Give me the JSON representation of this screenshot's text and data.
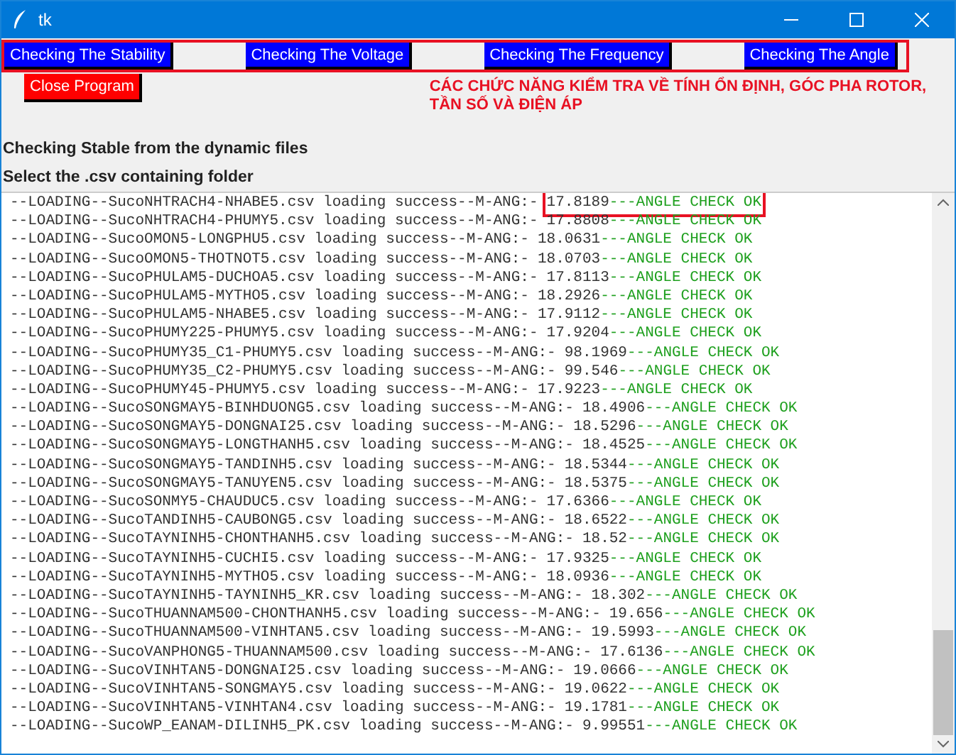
{
  "window": {
    "title": "tk"
  },
  "buttons": [
    {
      "label": "Checking The Stability",
      "kind": "check"
    },
    {
      "label": "Checking The Voltage",
      "kind": "check"
    },
    {
      "label": "Checking The Frequency",
      "kind": "check"
    },
    {
      "label": "Checking The Angle",
      "kind": "check"
    }
  ],
  "close_button": {
    "label": "Close Program"
  },
  "annotation": "CÁC CHỨC NĂNG KIỂM TRA VỀ TÍNH ỔN ĐỊNH, GÓC PHA ROTOR, TẦN SỐ VÀ ĐIỆN ÁP",
  "heading": "Checking Stable from the dynamic files",
  "subheading": "Select the .csv containing folder",
  "log": [
    {
      "prefix": "--LOADING--SucoNHTRACH4-NHABE5.csv loading success--M-ANG:-",
      "value": "17.8189",
      "status": "---ANGLE CHECK OK",
      "highlighted": true
    },
    {
      "prefix": "--LOADING--SucoNHTRACH4-PHUMY5.csv loading success--M-ANG:-",
      "value": "17.8808",
      "status": "---ANGLE CHECK OK",
      "highlighted": false
    },
    {
      "prefix": "--LOADING--SucoOMON5-LONGPHU5.csv loading success--M-ANG:-",
      "value": "18.0631",
      "status": "---ANGLE CHECK OK",
      "highlighted": false
    },
    {
      "prefix": "--LOADING--SucoOMON5-THOTNOT5.csv loading success--M-ANG:-",
      "value": "18.0703",
      "status": "---ANGLE CHECK OK",
      "highlighted": false
    },
    {
      "prefix": "--LOADING--SucoPHULAM5-DUCHOA5.csv loading success--M-ANG:-",
      "value": "17.8113",
      "status": "---ANGLE CHECK OK",
      "highlighted": false
    },
    {
      "prefix": "--LOADING--SucoPHULAM5-MYTHO5.csv loading success--M-ANG:-",
      "value": "18.2926",
      "status": "---ANGLE CHECK OK",
      "highlighted": false
    },
    {
      "prefix": "--LOADING--SucoPHULAM5-NHABE5.csv loading success--M-ANG:-",
      "value": "17.9112",
      "status": "---ANGLE CHECK OK",
      "highlighted": false
    },
    {
      "prefix": "--LOADING--SucoPHUMY225-PHUMY5.csv loading success--M-ANG:-",
      "value": "17.9204",
      "status": "---ANGLE CHECK OK",
      "highlighted": false
    },
    {
      "prefix": "--LOADING--SucoPHUMY35_C1-PHUMY5.csv loading success--M-ANG:-",
      "value": "98.1969",
      "status": "---ANGLE CHECK OK",
      "highlighted": false
    },
    {
      "prefix": "--LOADING--SucoPHUMY35_C2-PHUMY5.csv loading success--M-ANG:-",
      "value": "99.546",
      "status": "---ANGLE CHECK OK",
      "highlighted": false
    },
    {
      "prefix": "--LOADING--SucoPHUMY45-PHUMY5.csv loading success--M-ANG:-",
      "value": "17.9223",
      "status": "---ANGLE CHECK OK",
      "highlighted": false
    },
    {
      "prefix": "--LOADING--SucoSONGMAY5-BINHDUONG5.csv loading success--M-ANG:-",
      "value": "18.4906",
      "status": "---ANGLE CHECK OK",
      "highlighted": false
    },
    {
      "prefix": "--LOADING--SucoSONGMAY5-DONGNAI25.csv loading success--M-ANG:-",
      "value": "18.5296",
      "status": "---ANGLE CHECK OK",
      "highlighted": false
    },
    {
      "prefix": "--LOADING--SucoSONGMAY5-LONGTHANH5.csv loading success--M-ANG:-",
      "value": "18.4525",
      "status": "---ANGLE CHECK OK",
      "highlighted": false
    },
    {
      "prefix": "--LOADING--SucoSONGMAY5-TANDINH5.csv loading success--M-ANG:-",
      "value": "18.5344",
      "status": "---ANGLE CHECK OK",
      "highlighted": false
    },
    {
      "prefix": "--LOADING--SucoSONGMAY5-TANUYEN5.csv loading success--M-ANG:-",
      "value": "18.5375",
      "status": "---ANGLE CHECK OK",
      "highlighted": false
    },
    {
      "prefix": "--LOADING--SucoSONMY5-CHAUDUC5.csv loading success--M-ANG:-",
      "value": "17.6366",
      "status": "---ANGLE CHECK OK",
      "highlighted": false
    },
    {
      "prefix": "--LOADING--SucoTANDINH5-CAUBONG5.csv loading success--M-ANG:-",
      "value": "18.6522",
      "status": "---ANGLE CHECK OK",
      "highlighted": false
    },
    {
      "prefix": "--LOADING--SucoTAYNINH5-CHONTHANH5.csv loading success--M-ANG:-",
      "value": "18.52",
      "status": "---ANGLE CHECK OK",
      "highlighted": false
    },
    {
      "prefix": "--LOADING--SucoTAYNINH5-CUCHI5.csv loading success--M-ANG:-",
      "value": "17.9325",
      "status": "---ANGLE CHECK OK",
      "highlighted": false
    },
    {
      "prefix": "--LOADING--SucoTAYNINH5-MYTHO5.csv loading success--M-ANG:-",
      "value": "18.0936",
      "status": "---ANGLE CHECK OK",
      "highlighted": false
    },
    {
      "prefix": "--LOADING--SucoTAYNINH5-TAYNINH5_KR.csv loading success--M-ANG:-",
      "value": "18.302",
      "status": "---ANGLE CHECK OK",
      "highlighted": false
    },
    {
      "prefix": "--LOADING--SucoTHUANNAM500-CHONTHANH5.csv loading success--M-ANG:-",
      "value": "19.656",
      "status": "---ANGLE CHECK OK",
      "highlighted": false
    },
    {
      "prefix": "--LOADING--SucoTHUANNAM500-VINHTAN5.csv loading success--M-ANG:-",
      "value": "19.5993",
      "status": "---ANGLE CHECK OK",
      "highlighted": false
    },
    {
      "prefix": "--LOADING--SucoVANPHONG5-THUANNAM500.csv loading success--M-ANG:-",
      "value": "17.6136",
      "status": "---ANGLE CHECK OK",
      "highlighted": false
    },
    {
      "prefix": "--LOADING--SucoVINHTAN5-DONGNAI25.csv loading success--M-ANG:-",
      "value": "19.0666",
      "status": "---ANGLE CHECK OK",
      "highlighted": false
    },
    {
      "prefix": "--LOADING--SucoVINHTAN5-SONGMAY5.csv loading success--M-ANG:-",
      "value": "19.0622",
      "status": "---ANGLE CHECK OK",
      "highlighted": false
    },
    {
      "prefix": "--LOADING--SucoVINHTAN5-VINHTAN4.csv loading success--M-ANG:-",
      "value": "19.1781",
      "status": "---ANGLE CHECK OK",
      "highlighted": false
    },
    {
      "prefix": "--LOADING--SucoWP_EANAM-DILINH5_PK.csv loading success--M-ANG:-",
      "value": "9.99551",
      "status": "---ANGLE CHECK OK",
      "highlighted": false
    }
  ]
}
